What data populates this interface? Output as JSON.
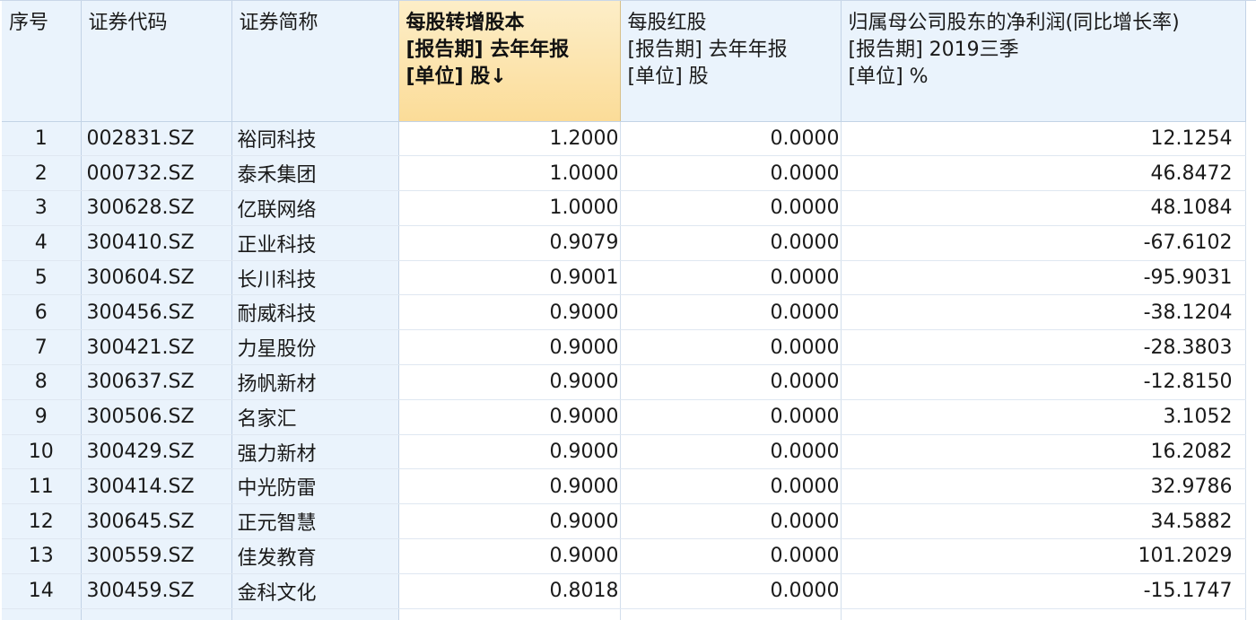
{
  "headers": {
    "index": "序号",
    "code": "证券代码",
    "name": "证券简称",
    "transfer_shares": [
      "每股转增股本",
      "[报告期] 去年年报",
      "[单位] 股↓"
    ],
    "bonus_shares": [
      "每股红股",
      "[报告期] 去年年报",
      "[单位] 股"
    ],
    "net_profit_growth": [
      "归属母公司股东的净利润(同比增长率)",
      "[报告期] 2019三季",
      "[单位] %"
    ]
  },
  "sorted_column_color": "#fbdc98",
  "frozen_column_color": "#eaf3fc",
  "rows": [
    {
      "index": "1",
      "code": "002831.SZ",
      "name": "裕同科技",
      "transfer": "1.2000",
      "bonus": "0.0000",
      "growth": "12.1254"
    },
    {
      "index": "2",
      "code": "000732.SZ",
      "name": "泰禾集团",
      "transfer": "1.0000",
      "bonus": "0.0000",
      "growth": "46.8472"
    },
    {
      "index": "3",
      "code": "300628.SZ",
      "name": "亿联网络",
      "transfer": "1.0000",
      "bonus": "0.0000",
      "growth": "48.1084"
    },
    {
      "index": "4",
      "code": "300410.SZ",
      "name": "正业科技",
      "transfer": "0.9079",
      "bonus": "0.0000",
      "growth": "-67.6102"
    },
    {
      "index": "5",
      "code": "300604.SZ",
      "name": "长川科技",
      "transfer": "0.9001",
      "bonus": "0.0000",
      "growth": "-95.9031"
    },
    {
      "index": "6",
      "code": "300456.SZ",
      "name": "耐威科技",
      "transfer": "0.9000",
      "bonus": "0.0000",
      "growth": "-38.1204"
    },
    {
      "index": "7",
      "code": "300421.SZ",
      "name": "力星股份",
      "transfer": "0.9000",
      "bonus": "0.0000",
      "growth": "-28.3803"
    },
    {
      "index": "8",
      "code": "300637.SZ",
      "name": "扬帆新材",
      "transfer": "0.9000",
      "bonus": "0.0000",
      "growth": "-12.8150"
    },
    {
      "index": "9",
      "code": "300506.SZ",
      "name": "名家汇",
      "transfer": "0.9000",
      "bonus": "0.0000",
      "growth": "3.1052"
    },
    {
      "index": "10",
      "code": "300429.SZ",
      "name": "强力新材",
      "transfer": "0.9000",
      "bonus": "0.0000",
      "growth": "16.2082"
    },
    {
      "index": "11",
      "code": "300414.SZ",
      "name": "中光防雷",
      "transfer": "0.9000",
      "bonus": "0.0000",
      "growth": "32.9786"
    },
    {
      "index": "12",
      "code": "300645.SZ",
      "name": "正元智慧",
      "transfer": "0.9000",
      "bonus": "0.0000",
      "growth": "34.5882"
    },
    {
      "index": "13",
      "code": "300559.SZ",
      "name": "佳发教育",
      "transfer": "0.9000",
      "bonus": "0.0000",
      "growth": "101.2029"
    },
    {
      "index": "14",
      "code": "300459.SZ",
      "name": "金科文化",
      "transfer": "0.8018",
      "bonus": "0.0000",
      "growth": "-15.1747"
    }
  ]
}
